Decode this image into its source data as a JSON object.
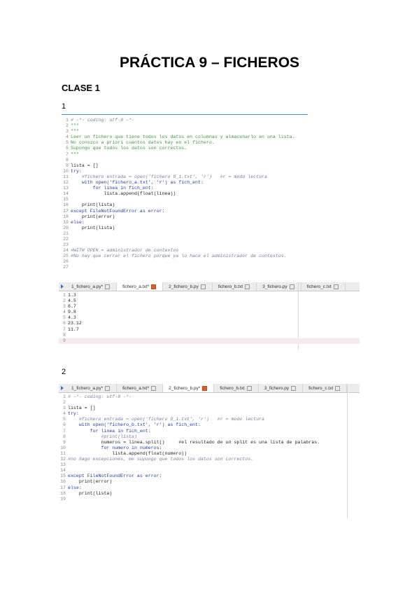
{
  "title": "PRÁCTICA 9 – FICHEROS",
  "section": "CLASE 1",
  "shot1": {
    "number": "1",
    "lines": [
      {
        "n": "1",
        "cls": "c-com",
        "t": "# -*- coding: utf-8 -*-"
      },
      {
        "n": "2",
        "cls": "c-doc",
        "t": "\"\"\""
      },
      {
        "n": "3",
        "cls": "c-doc",
        "t": "\"\"\""
      },
      {
        "n": "4",
        "cls": "c-doc",
        "t": "Leer un fichero que tiene todos los datos en columnas y almacenarlo en una lista."
      },
      {
        "n": "5",
        "cls": "c-doc",
        "t": "No conozco a priori cuantos datos hay en el fichero."
      },
      {
        "n": "6",
        "cls": "c-doc",
        "t": "Supongo que todos los datos son correctos."
      },
      {
        "n": "7",
        "cls": "c-doc",
        "t": "\"\"\""
      },
      {
        "n": "8",
        "cls": "c-plain",
        "t": ""
      },
      {
        "n": "9",
        "cls": "c-plain",
        "t": "lista = []"
      },
      {
        "n": "10",
        "cls": "c-kw",
        "t": "try:"
      },
      {
        "n": "11",
        "cls": "c-com",
        "t": "    #fichero entrada = open('fichero 9_1.txt', 'r')   #r = modo lectura"
      },
      {
        "n": "12",
        "cls": "c-kw",
        "t": "    with open('fichero_a.txt', 'r') as fich_ent:"
      },
      {
        "n": "13",
        "cls": "c-kw",
        "t": "        for linea in fich_ent:"
      },
      {
        "n": "14",
        "cls": "c-plain",
        "t": "            lista.append(float(linea))"
      },
      {
        "n": "15",
        "cls": "c-plain",
        "t": ""
      },
      {
        "n": "16",
        "cls": "c-plain",
        "t": "    print(lista)"
      },
      {
        "n": "17",
        "cls": "c-kw",
        "t": "except FileNotFoundError as error:"
      },
      {
        "n": "18",
        "cls": "c-plain",
        "t": "    print(error)"
      },
      {
        "n": "19",
        "cls": "c-kw",
        "t": "else:"
      },
      {
        "n": "20",
        "cls": "c-plain",
        "t": "    print(lista)"
      },
      {
        "n": "21",
        "cls": "c-plain",
        "t": ""
      },
      {
        "n": "22",
        "cls": "c-plain",
        "t": ""
      },
      {
        "n": "23",
        "cls": "c-plain",
        "t": ""
      },
      {
        "n": "24",
        "cls": "c-com",
        "t": "#WITH OPEN = administrador de contextos"
      },
      {
        "n": "25",
        "cls": "c-com",
        "t": "#No hay que cerrar el fichero porque ya lo hace el administrador de contextos."
      },
      {
        "n": "26",
        "cls": "c-plain",
        "t": ""
      },
      {
        "n": "27",
        "cls": "c-plain",
        "t": ""
      }
    ],
    "tabs": [
      {
        "label": "1_fichero_a.py*",
        "active": false
      },
      {
        "label": "fichero_a.txt*",
        "active": true
      },
      {
        "label": "2_fichero_b.py",
        "active": false
      },
      {
        "label": "fichero_b.txt",
        "active": false
      },
      {
        "label": "3_fichero.py",
        "active": false
      },
      {
        "label": "fichero_c.txt",
        "active": false
      }
    ],
    "data_lines": [
      {
        "n": "1",
        "t": "1.3"
      },
      {
        "n": "2",
        "t": "4.5"
      },
      {
        "n": "3",
        "t": "6.7"
      },
      {
        "n": "4",
        "t": "9.8"
      },
      {
        "n": "5",
        "t": "4.3"
      },
      {
        "n": "6",
        "t": "23.12"
      },
      {
        "n": "7",
        "t": "11.7"
      },
      {
        "n": "8",
        "t": ""
      },
      {
        "n": "9",
        "t": ""
      }
    ]
  },
  "shot2": {
    "number": "2",
    "tabs": [
      {
        "label": "1_fichero_a.py*",
        "active": false
      },
      {
        "label": "fichero_a.txt*",
        "active": false
      },
      {
        "label": "2_fichero_b.py*",
        "active": true
      },
      {
        "label": "fichero_b.txt",
        "active": false
      },
      {
        "label": "3_fichero.py",
        "active": false
      },
      {
        "label": "fichero_c.txt",
        "active": false
      }
    ],
    "lines": [
      {
        "n": "1",
        "cls": "c-com",
        "t": "# -*- coding: utf-8 -*-"
      },
      {
        "n": "2",
        "cls": "c-plain",
        "t": ""
      },
      {
        "n": "3",
        "cls": "c-plain",
        "t": "lista = []"
      },
      {
        "n": "4",
        "cls": "c-kw",
        "t": "try:"
      },
      {
        "n": "5",
        "cls": "c-com",
        "t": "    #fichero entrada = open('fichero 9_1.txt', 'r')   #r = modo lectura"
      },
      {
        "n": "6",
        "cls": "c-kw",
        "t": "    with open('fichero_b.txt', 'r') as fich_ent:"
      },
      {
        "n": "7",
        "cls": "c-kw",
        "t": "        for linea in fich_ent:"
      },
      {
        "n": "8",
        "cls": "c-com",
        "t": "            #print(lista)"
      },
      {
        "n": "9",
        "cls": "c-plain",
        "t": "            numeros = linea.split()     #el resultado de un split es una lista de palabras."
      },
      {
        "n": "10",
        "cls": "c-kw",
        "t": "            for numero in numeros:"
      },
      {
        "n": "11",
        "cls": "c-plain",
        "t": "                lista.append(float(numero))"
      },
      {
        "n": "12",
        "cls": "c-com",
        "t": "#no hago excepciones, me supongo que todos los datos son correctos."
      },
      {
        "n": "13",
        "cls": "c-plain",
        "t": ""
      },
      {
        "n": "14",
        "cls": "c-plain",
        "t": ""
      },
      {
        "n": "15",
        "cls": "c-kw",
        "t": "except FileNotFoundError as error:"
      },
      {
        "n": "16",
        "cls": "c-plain",
        "t": "    print(error)"
      },
      {
        "n": "17",
        "cls": "c-kw",
        "t": "else:"
      },
      {
        "n": "18",
        "cls": "c-plain",
        "t": "    print(lista)"
      },
      {
        "n": "19",
        "cls": "c-plain",
        "t": ""
      }
    ]
  }
}
